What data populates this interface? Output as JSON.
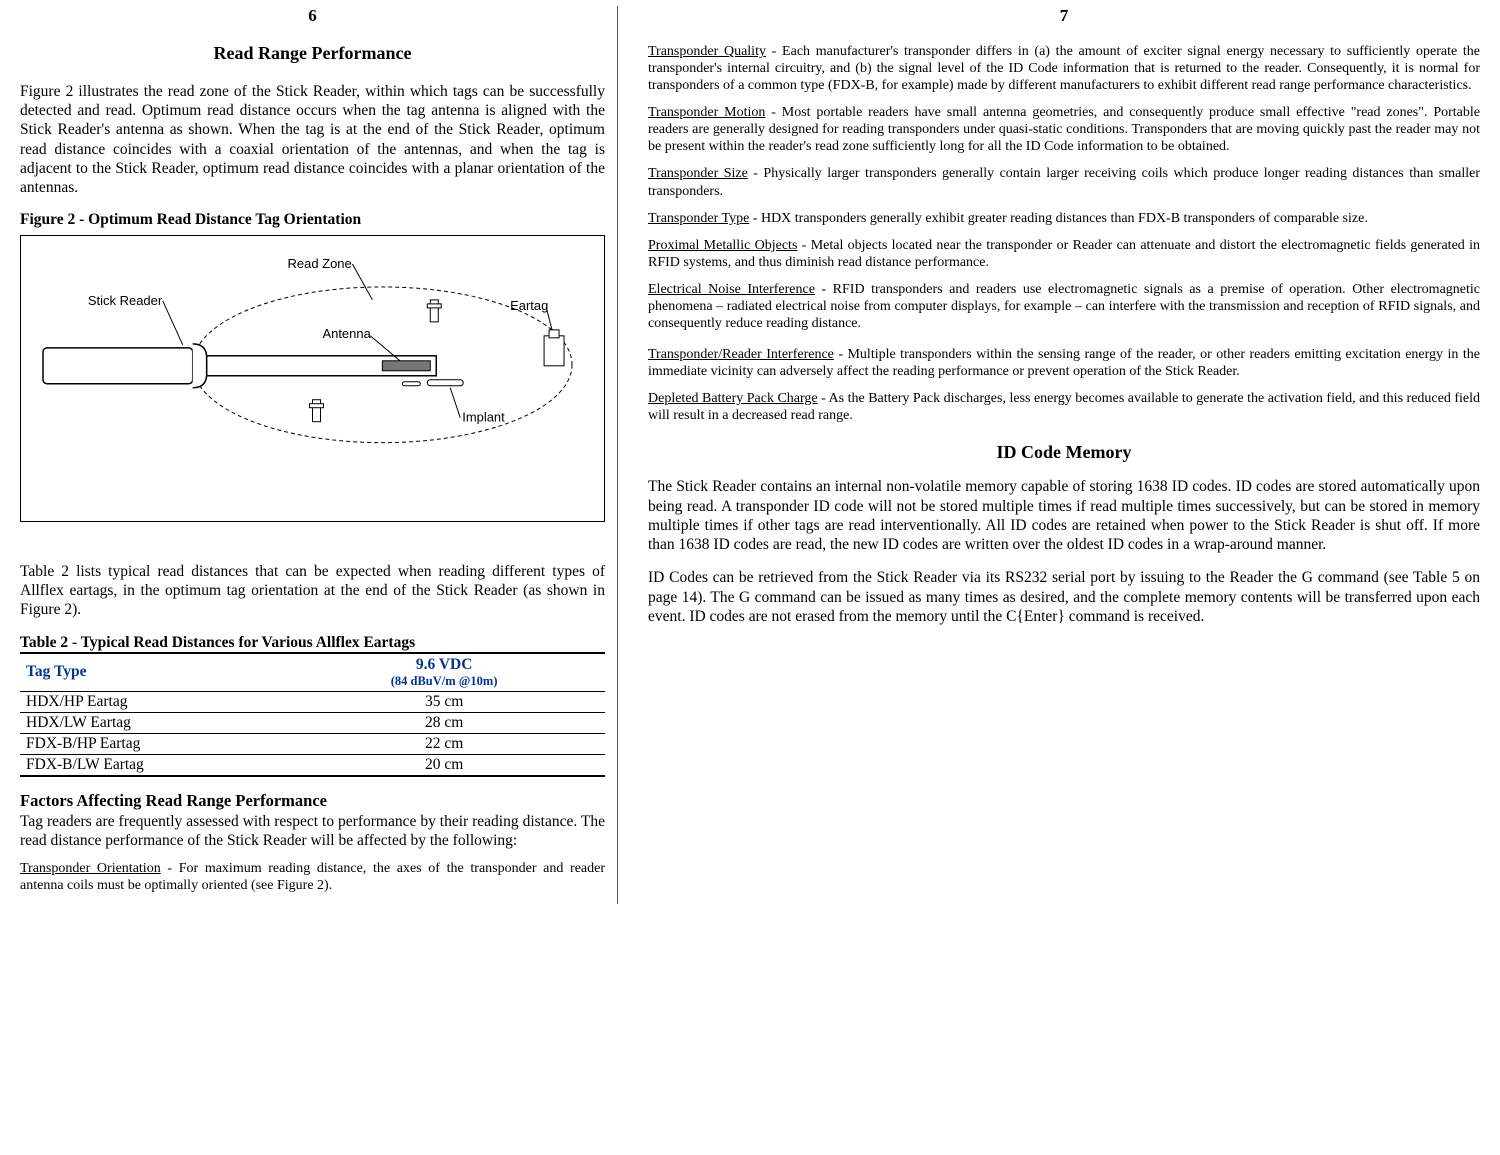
{
  "left": {
    "page_num": "6",
    "title": "Read Range Performance",
    "para1": "Figure 2 illustrates the read zone of the Stick Reader, within which tags can be successfully detected and read.  Optimum read distance occurs when the tag antenna is aligned with the Stick Reader's antenna as shown.  When  the tag is at the end of the Stick Reader, optimum read distance coincides with a coaxial orientation of the antennas, and when the tag is adjacent to the Stick Reader, optimum read distance coincides with a planar orientation of the antennas.",
    "fig_caption": "Figure 2  -  Optimum Read Distance Tag Orientation",
    "fig_labels": {
      "read_zone": "Read Zone",
      "stick_reader": "Stick Reader",
      "antenna": "Antenna",
      "eartag": "Eartag",
      "implant": "Implant"
    },
    "para2": "Table 2 lists typical read distances that can be expected when reading different types of Allflex eartags, in the optimum tag orientation at the end of the Stick Reader (as shown in Figure 2).",
    "table_caption": "Table 2  -  Typical Read Distances for Various Allflex Eartags",
    "table": {
      "head_col1": "Tag Type",
      "head_col2": "9.6 VDC",
      "head_col2_sub": "(84 dBuV/m @10m)",
      "rows": [
        {
          "tag": "HDX/HP Eartag",
          "val": "35 cm"
        },
        {
          "tag": "HDX/LW Eartag",
          "val": "28 cm"
        },
        {
          "tag": "FDX-B/HP Eartag",
          "val": "22 cm"
        },
        {
          "tag": "FDX-B/LW Eartag",
          "val": "20 cm"
        }
      ]
    },
    "factors_head": "Factors Affecting Read Range Performance",
    "factors_intro": "Tag readers are frequently assessed with respect to performance by their reading distance.  The read distance performance of the Stick Reader will be affected by the following:",
    "orient_label": "Transponder Orientation",
    "orient_text": "  -  For maximum reading distance, the axes of the transponder and reader antenna coils must be optimally oriented (see Figure 2)."
  },
  "right": {
    "page_num": "7",
    "items": [
      {
        "label": "Transponder Quality",
        "text": "  -  Each manufacturer's transponder differs in (a) the amount of exciter signal energy necessary to sufficiently operate the transponder's internal circuitry, and (b) the signal level of the ID Code information that is returned to the reader.  Consequently, it is normal for transponders of a common type (FDX-B, for example) made by different manufacturers to exhibit different read range performance characteristics."
      },
      {
        "label": "Transponder Motion",
        "text": "   -   Most portable readers have small antenna geometries, and consequently produce small effective \"read zones\".  Portable readers are generally designed for reading transponders under quasi-static conditions.  Transponders that are moving quickly past the reader may not be present within the reader's read zone sufficiently long for all the ID Code information to be obtained."
      },
      {
        "label": "Transponder Size",
        "text": "  - Physically larger transponders generally contain larger receiving coils which produce longer reading distances than smaller transponders."
      },
      {
        "label": "Transponder Type",
        "text": "  -  HDX transponders generally exhibit greater reading distances than FDX-B transponders of comparable size."
      },
      {
        "label": "Proximal Metallic Objects",
        "text": "  -  Metal objects located near the transponder or Reader can attenuate and distort the electromagnetic fields generated in RFID systems, and thus diminish read distance performance."
      },
      {
        "label": "Electrical Noise Interference",
        "text": "  -  RFID transponders and readers use electromagnetic signals as a premise of operation.  Other electromagnetic phenomena – radiated electrical noise from computer displays, for example – can interfere with the transmission and reception of RFID signals, and consequently reduce reading distance."
      },
      {
        "label": "Transponder/Reader Interference",
        "text": "  -  Multiple transponders within the sensing range of the reader, or other readers emitting excitation energy in the immediate vicinity can adversely affect the reading performance or prevent operation of the Stick Reader."
      },
      {
        "label": "Depleted Battery Pack Charge",
        "text": "  -  As the Battery Pack discharges, less energy becomes available to generate the activation field, and this reduced field will result in a decreased read range."
      }
    ],
    "mem_title": "ID Code Memory",
    "mem_para1": "The Stick Reader contains an internal non-volatile memory capable of storing 1638 ID codes.  ID codes are stored automatically upon being read.  A transponder ID code will not be stored multiple times if read multiple times successively, but can be stored in memory multiple times if other tags are read interventionally.  All ID codes are retained when power to the Stick Reader is shut off.  If more than 1638 ID codes are read, the new ID codes are written over the oldest ID codes in a wrap-around manner.",
    "mem_para2": "ID Codes can be retrieved from the Stick Reader via its RS232 serial port by issuing to the Reader the G command (see Table 5 on page 14).  The G command can be issued as many times as desired, and the complete memory contents will be transferred upon each event.  ID codes are not erased from the memory until the C{Enter} command is received."
  }
}
